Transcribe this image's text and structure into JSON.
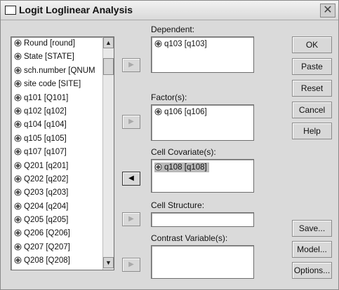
{
  "window": {
    "title": "Logit Loglinear Analysis"
  },
  "variables": [
    "Round [round]",
    "State [STATE]",
    "sch.number [QNUM",
    "site code [SITE]",
    "q101 [Q101]",
    "q102 [q102]",
    "q104 [q104]",
    "q105 [q105]",
    "q107 [q107]",
    "Q201 [q201]",
    "Q202 [q202]",
    "Q203 [q203]",
    "Q204 [q204]",
    "Q205 [q205]",
    "Q206 [Q206]",
    "Q207 [Q207]",
    "Q208 [Q208]"
  ],
  "fields": {
    "dependent": {
      "label": "Dependent:",
      "value": "q103 [q103]"
    },
    "factors": {
      "label": "Factor(s):",
      "value": "q106 [q106]"
    },
    "cell_covariates": {
      "label": "Cell Covariate(s):",
      "value": "q108 [q108]"
    },
    "cell_structure": {
      "label": "Cell Structure:",
      "value": ""
    },
    "contrast_variables": {
      "label": "Contrast Variable(s):",
      "value": ""
    }
  },
  "buttons": {
    "ok": "OK",
    "paste": "Paste",
    "reset": "Reset",
    "cancel": "Cancel",
    "help": "Help",
    "save": "Save...",
    "model": "Model...",
    "options": "Options..."
  }
}
